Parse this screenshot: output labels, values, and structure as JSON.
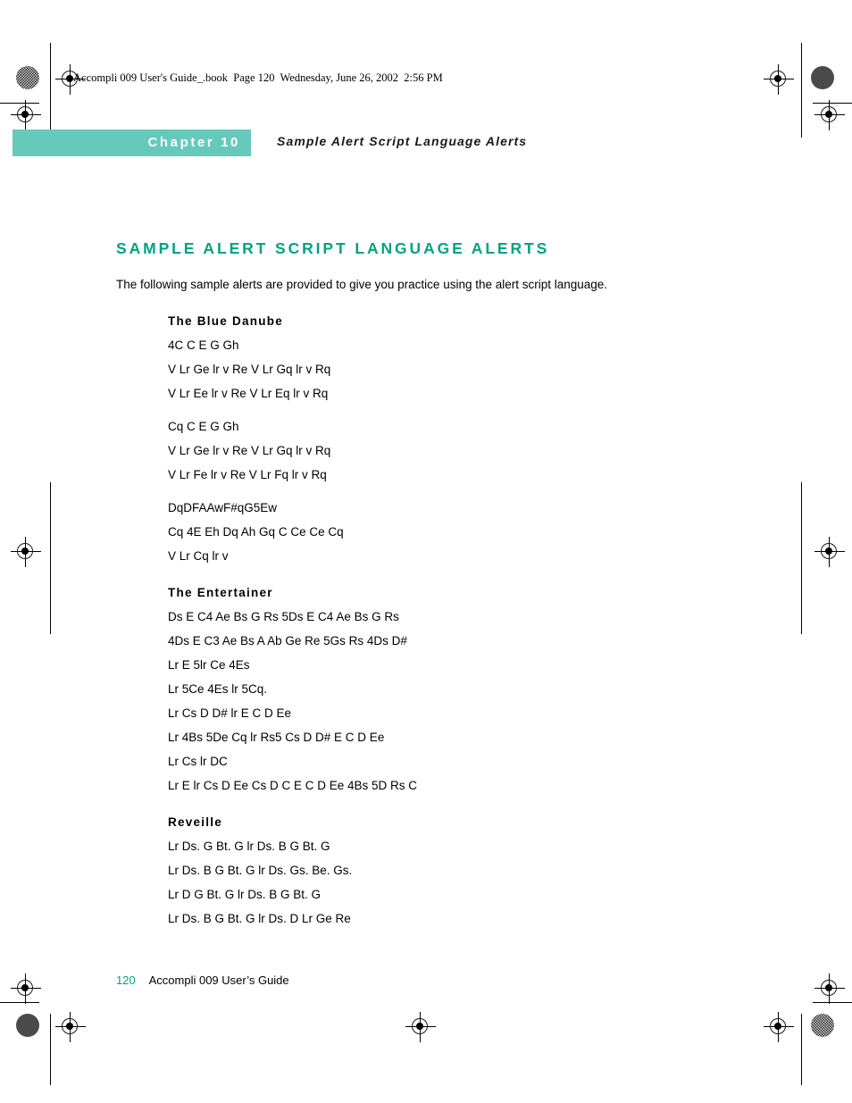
{
  "running_header": "Accompli 009 User's Guide_.book  Page 120  Wednesday, June 26, 2002  2:56 PM",
  "chapter": {
    "label": "Chapter 10",
    "subtitle": "Sample Alert Script Language Alerts",
    "bar_color": "#66c9bc"
  },
  "main": {
    "section_title": "SAMPLE ALERT SCRIPT LANGUAGE ALERTS",
    "section_title_color": "#00a383",
    "intro": "The following sample alerts are provided to give you practice using the alert script language.",
    "sections": [
      {
        "heading": "The Blue Danube",
        "stanzas": [
          [
            "4C C E G Gh",
            "V Lr Ge lr v Re V Lr Gq lr v Rq",
            "V Lr Ee lr v Re V Lr Eq lr v Rq"
          ],
          [
            "Cq C E G Gh",
            "V Lr Ge lr v Re V Lr Gq lr v Rq",
            "V Lr Fe lr v Re V Lr Fq lr v Rq"
          ],
          [
            "DqDFAAwF#qG5Ew",
            "Cq 4E Eh Dq Ah Gq C Ce Ce Cq",
            "V Lr Cq lr v"
          ]
        ]
      },
      {
        "heading": "The Entertainer",
        "stanzas": [
          [
            "Ds E C4 Ae Bs G Rs 5Ds E C4 Ae Bs G Rs",
            "4Ds E C3 Ae Bs A Ab Ge Re 5Gs Rs 4Ds D#",
            "Lr E 5lr Ce 4Es",
            "Lr 5Ce 4Es lr 5Cq.",
            "Lr Cs D D# lr E C D Ee",
            "Lr 4Bs 5De Cq lr Rs5 Cs D D# E C D Ee",
            "Lr Cs lr DC",
            "Lr E lr Cs D Ee Cs D C E C D Ee 4Bs 5D Rs C"
          ]
        ]
      },
      {
        "heading": "Reveille",
        "stanzas": [
          [
            "Lr Ds. G Bt. G lr Ds. B G Bt. G",
            "Lr Ds. B G Bt. G lr Ds. Gs. Be. Gs.",
            "Lr D G Bt. G lr Ds. B G Bt. G",
            "Lr Ds. B G Bt. G lr Ds. D Lr Ge Re"
          ]
        ]
      }
    ]
  },
  "footer": {
    "page_number": "120",
    "guide_title": "Accompli 009 User’s Guide",
    "page_number_color": "#00a383"
  }
}
